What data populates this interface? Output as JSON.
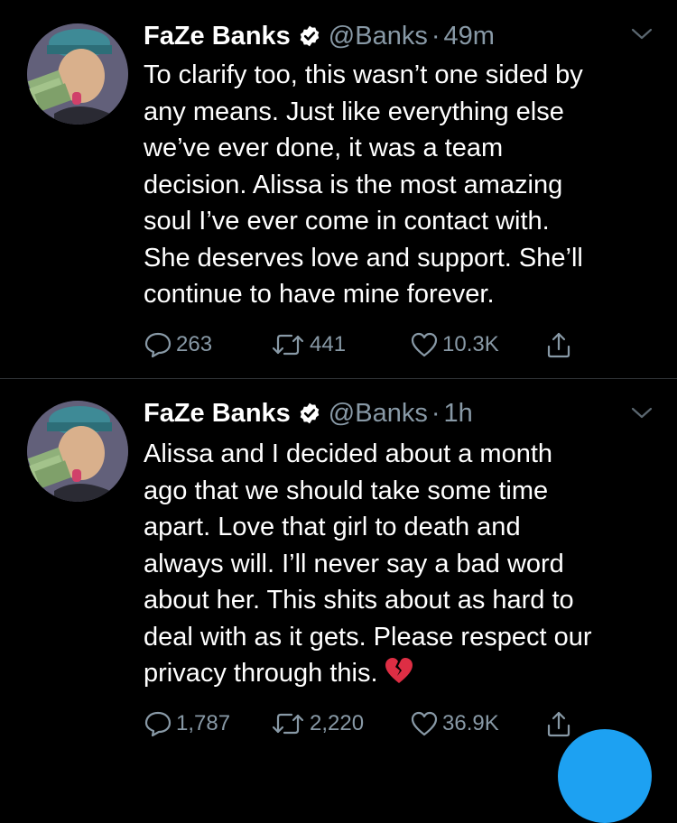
{
  "colors": {
    "background": "#000000",
    "text": "#ffffff",
    "muted": "#8899a6",
    "divider": "#2f3336",
    "accent": "#1da1f2"
  },
  "tweets": [
    {
      "name": "FaZe Banks",
      "handle": "@Banks",
      "separator": "·",
      "time": "49m",
      "text": "To clarify too, this wasn’t one sided by\nany means. Just like everything else\nwe’ve ever done, it was a team\ndecision. Alissa is the most amazing\nsoul I’ve ever come in contact with.\nShe deserves love and support. She’ll\ncontinue to have mine forever.",
      "replies": "263",
      "retweets": "441",
      "likes": "10.3K"
    },
    {
      "name": "FaZe Banks",
      "handle": "@Banks",
      "separator": "·",
      "time": "1h",
      "text": "Alissa and I decided about a month\nago that we should take some time\napart. Love that girl to death and\nalways will. I’ll never say a bad word\nabout her. This shits about as hard to\ndeal with as it gets. Please respect our\nprivacy through this.",
      "emoji": "broken-heart-emoji",
      "replies": "1,787",
      "retweets": "2,220",
      "likes": "36.9K"
    }
  ],
  "icons": {
    "verified": "verified-badge-icon",
    "more": "chevron-down-icon",
    "reply": "reply-icon",
    "retweet": "retweet-icon",
    "like": "heart-icon",
    "share": "share-icon",
    "compose": "compose-fab"
  }
}
